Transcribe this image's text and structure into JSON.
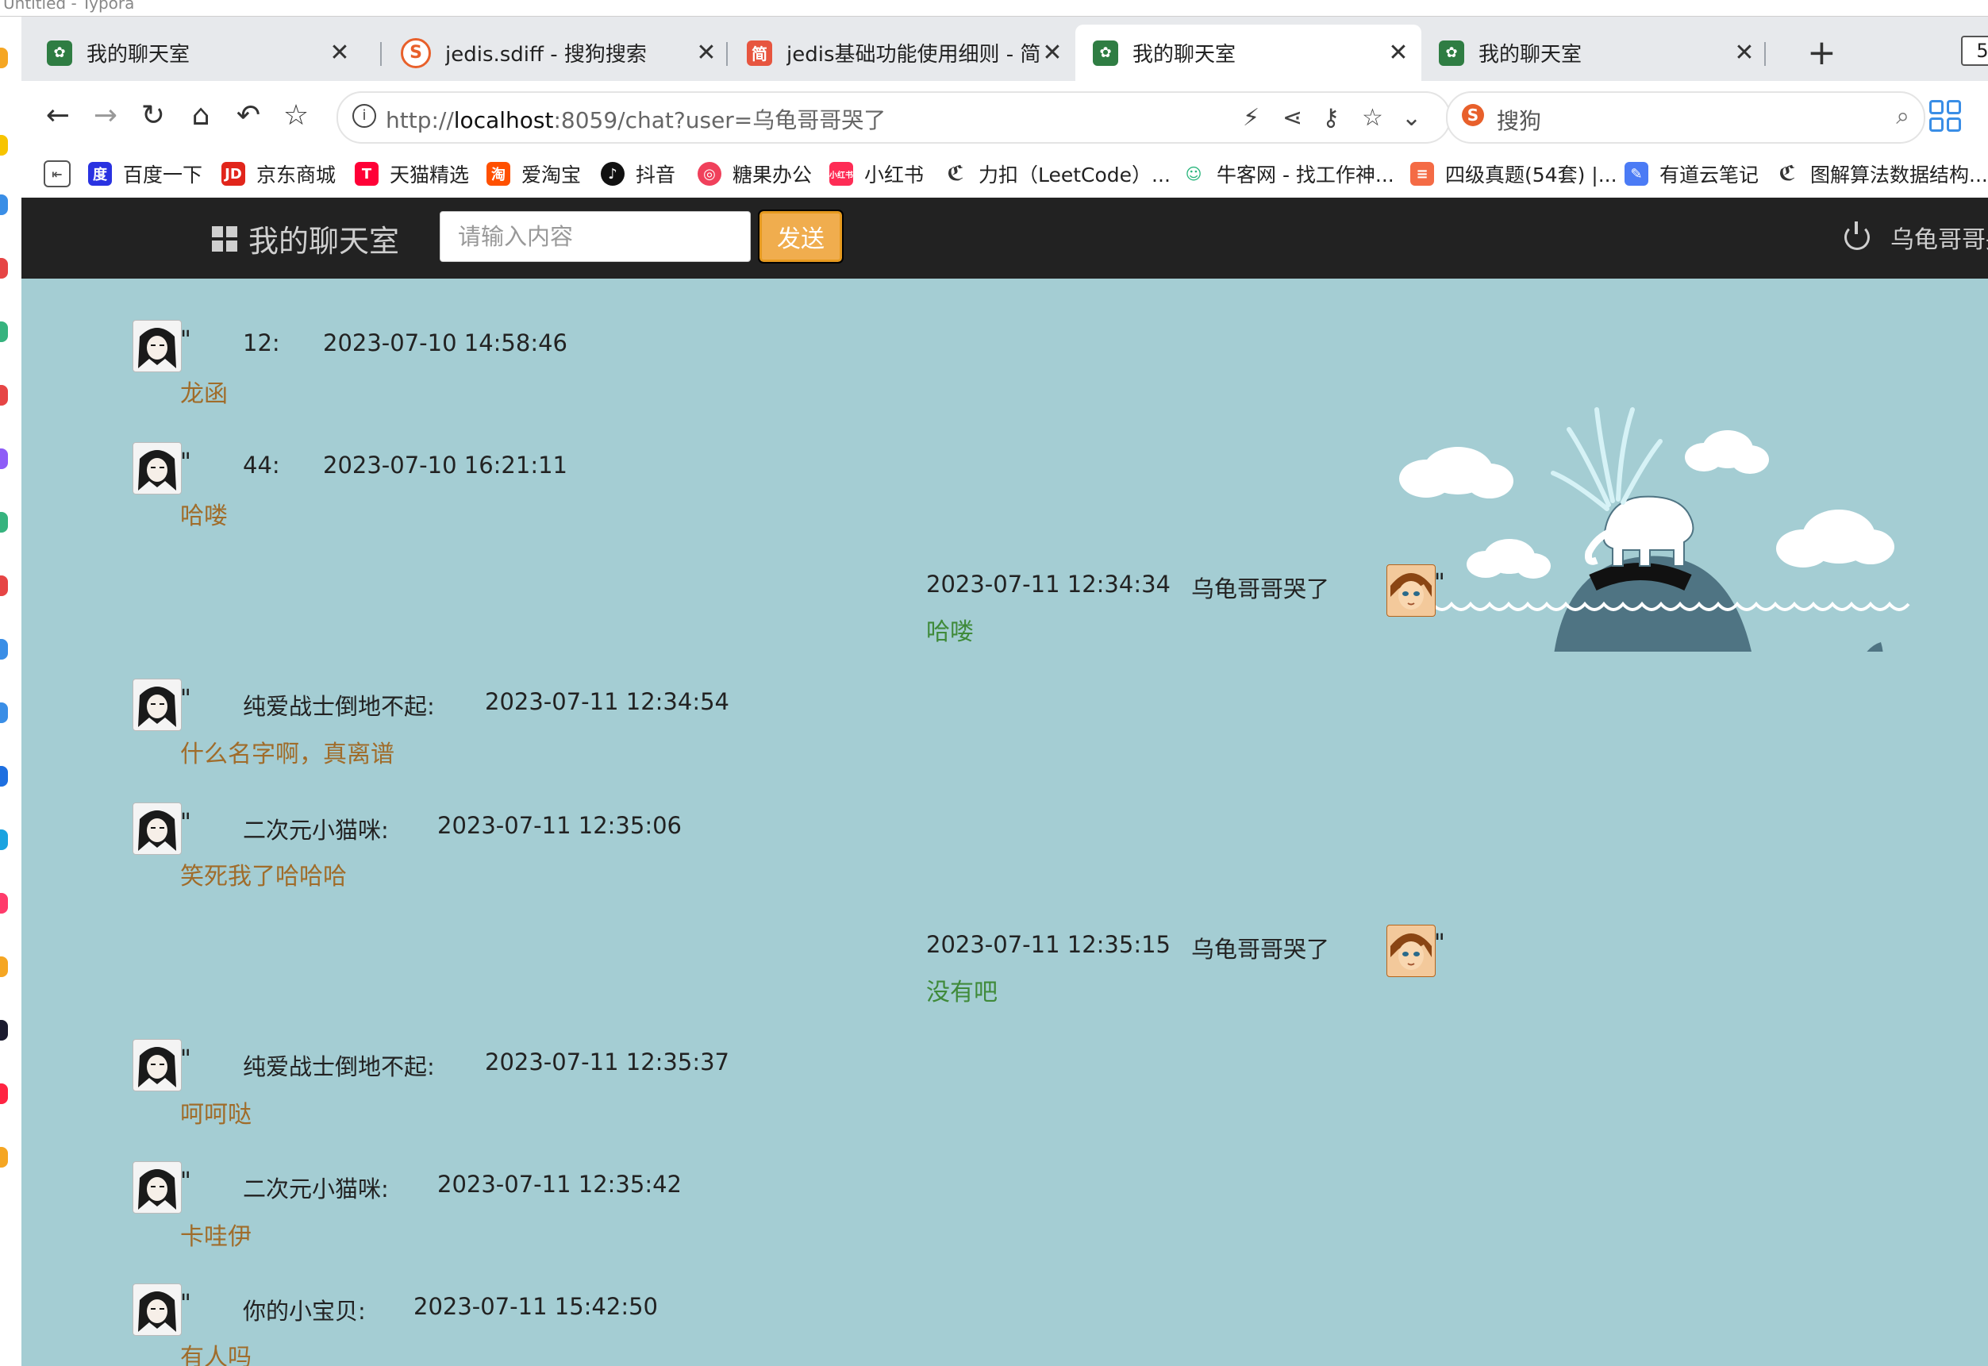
{
  "window": {
    "top_text": "Untitled - Typora"
  },
  "tabs": [
    {
      "title": "我的聊天室",
      "icon": "leaf-icon",
      "active": false
    },
    {
      "title": "jedis.sdiff - 搜狗搜索",
      "icon": "sogou-icon",
      "active": false
    },
    {
      "title": "jedis基础功能使用细则 - 简书",
      "icon": "jianshu-icon",
      "active": false
    },
    {
      "title": "我的聊天室",
      "icon": "leaf-icon",
      "active": true
    },
    {
      "title": "我的聊天室",
      "icon": "leaf-icon",
      "active": false
    }
  ],
  "tab_close_symbol": "✕",
  "new_tab_symbol": "+",
  "tab_count": "5",
  "address": {
    "scheme": "http://",
    "host": "localhost",
    "rest": ":8059/chat?user=乌龟哥哥哭了"
  },
  "search": {
    "placeholder": "搜狗",
    "logo": "S"
  },
  "bookmarks": [
    {
      "label": "百度一下",
      "icon": "baidu-icon",
      "color": "#2932e1"
    },
    {
      "label": "京东商城",
      "icon": "jd-icon",
      "color": "#e1251b"
    },
    {
      "label": "天猫精选",
      "icon": "tmall-icon",
      "color": "#ff0036"
    },
    {
      "label": "爱淘宝",
      "icon": "taobao-icon",
      "color": "#ff5000"
    },
    {
      "label": "抖音",
      "icon": "douyin-icon",
      "color": "#111111"
    },
    {
      "label": "糖果办公",
      "icon": "tangguo-icon",
      "color": "#f0405b"
    },
    {
      "label": "小红书",
      "icon": "xiaohongshu-icon",
      "color": "#fe2c55"
    },
    {
      "label": "力扣（LeetCode）...",
      "icon": "leetcode-icon",
      "color": "#333333"
    },
    {
      "label": "牛客网 - 找工作神...",
      "icon": "nowcoder-icon",
      "color": "#29b57c"
    },
    {
      "label": "四级真题(54套) |...",
      "icon": "doc-icon",
      "color": "#f46b45"
    },
    {
      "label": "有道云笔记",
      "icon": "youdao-icon",
      "color": "#4b7bf5"
    },
    {
      "label": "图解算法数据结构...",
      "icon": "leetcode-icon",
      "color": "#333333"
    }
  ],
  "site": {
    "brand": "我的聊天室",
    "input_placeholder": "请输入内容",
    "send_label": "发送",
    "current_user": "乌龟哥哥哭了"
  },
  "messages": [
    {
      "side": "other",
      "user": "12:",
      "time": "2023-07-10 14:58:46",
      "text": "龙函"
    },
    {
      "side": "other",
      "user": "44:",
      "time": "2023-07-10 16:21:11",
      "text": "哈喽"
    },
    {
      "side": "self",
      "user": "乌龟哥哥哭了",
      "time": "2023-07-11 12:34:34",
      "text": "哈喽"
    },
    {
      "side": "other",
      "user": "纯爱战士倒地不起:",
      "time": "2023-07-11 12:34:54",
      "text": "什么名字啊，真离谱"
    },
    {
      "side": "other",
      "user": "二次元小猫咪:",
      "time": "2023-07-11 12:35:06",
      "text": "笑死我了哈哈哈"
    },
    {
      "side": "self",
      "user": "乌龟哥哥哭了",
      "time": "2023-07-11 12:35:15",
      "text": "没有吧"
    },
    {
      "side": "other",
      "user": "纯爱战士倒地不起:",
      "time": "2023-07-11 12:35:37",
      "text": "呵呵哒"
    },
    {
      "side": "other",
      "user": "二次元小猫咪:",
      "time": "2023-07-11 12:35:42",
      "text": "卡哇伊"
    },
    {
      "side": "other",
      "user": "你的小宝贝:",
      "time": "2023-07-11 15:42:50",
      "text": "有人吗"
    }
  ],
  "avatar_quote": "\"",
  "colors": {
    "header_bg": "#222222",
    "chat_bg": "#a4cdd3",
    "send_button": "#f0ad4e",
    "other_text": "#a06c2a",
    "self_text": "#3f8a3a"
  }
}
